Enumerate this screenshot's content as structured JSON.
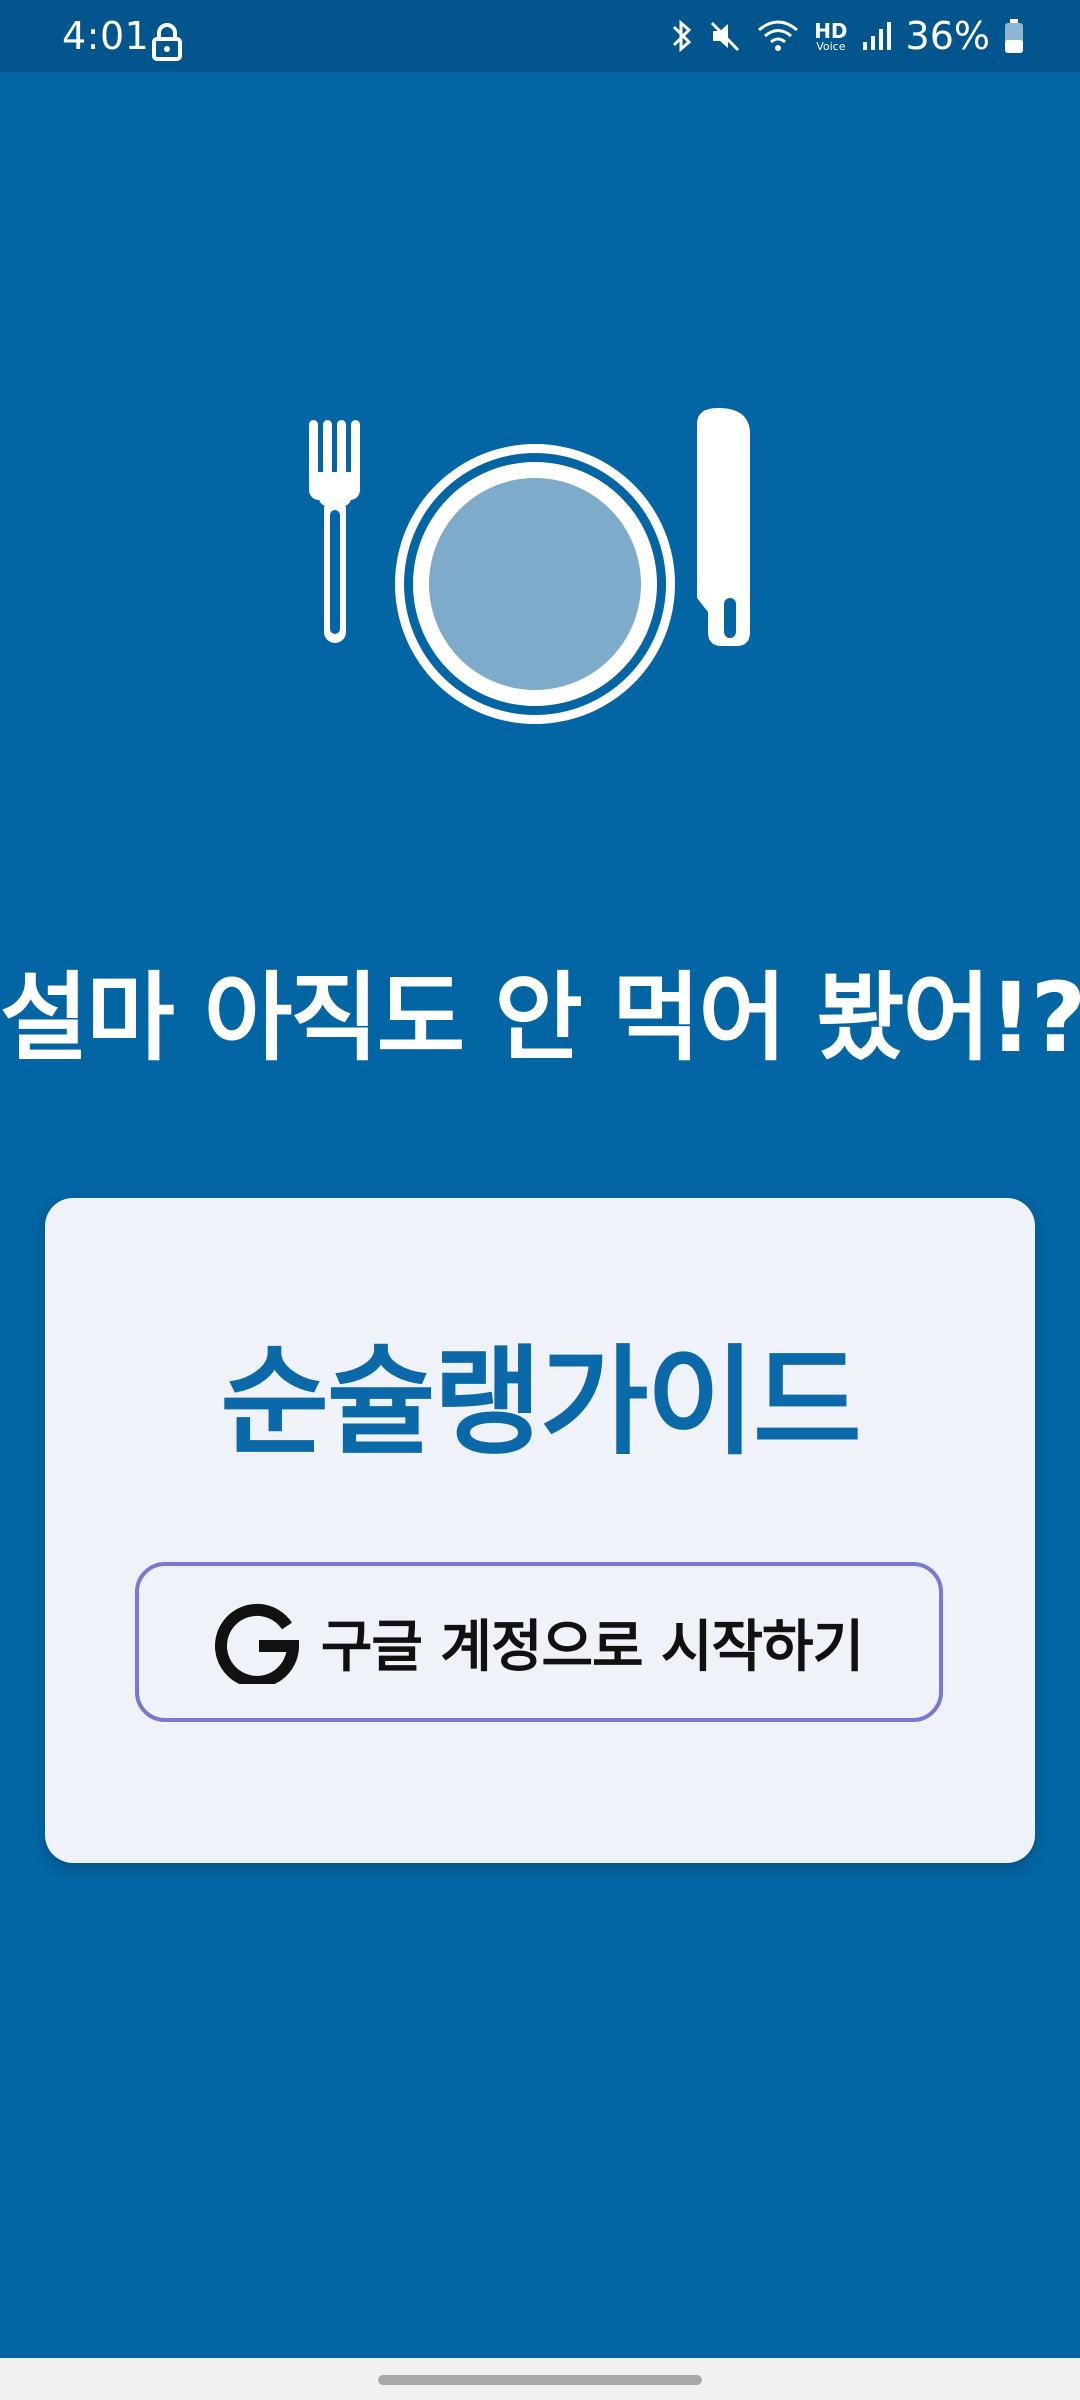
{
  "status_bar": {
    "time": "4:01",
    "battery_percent": "36%",
    "hd_label": "HD",
    "voice_label": "Voice",
    "icons": [
      "lock-icon",
      "bluetooth-icon",
      "mute-icon",
      "wifi-icon",
      "hd-voice-icon",
      "signal-icon",
      "battery-icon"
    ]
  },
  "hero": {
    "illustration": "fork-plate-knife-icon",
    "headline": "설마 아직도 안 먹어 봤어!?"
  },
  "card": {
    "app_title": "순슐랭가이드",
    "google_button": {
      "label": "구글 계정으로 시작하기",
      "icon": "google-g-icon"
    }
  },
  "colors": {
    "background": "#0465a4",
    "status_bar": "#03558d",
    "card": "#eff3f9",
    "title": "#0b69a9",
    "button_border": "#7a78d6",
    "plate_center": "#7eabc9"
  }
}
